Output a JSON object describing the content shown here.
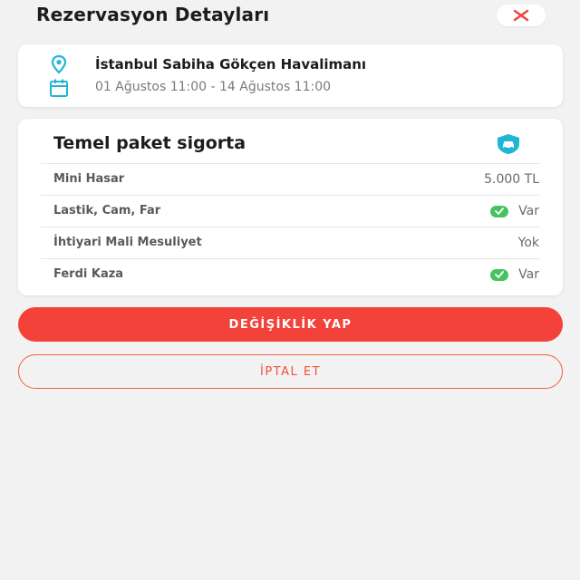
{
  "header": {
    "title": "Rezervasyon Detayları",
    "close_icon": "close-icon"
  },
  "location": {
    "name": "İstanbul Sabiha Gökçen Havalimanı",
    "dates": "01 Ağustos 11:00 - 14 Ağustos 11:00",
    "location_icon": "location-pin-icon",
    "calendar_icon": "calendar-icon"
  },
  "insurance": {
    "title": "Temel paket sigorta",
    "icon": "car-shield-icon",
    "rows": [
      {
        "label": "Mini Hasar",
        "value": "5.000 TL",
        "check": false
      },
      {
        "label": "Lastik, Cam, Far",
        "value": "Var",
        "check": true
      },
      {
        "label": "İhtiyari Mali Mesuliyet",
        "value": "Yok",
        "check": false
      },
      {
        "label": "Ferdi Kaza",
        "value": "Var",
        "check": true
      }
    ]
  },
  "actions": {
    "modify_label": "DEĞİŞİKLİK YAP",
    "cancel_label": "İPTAL ET"
  },
  "colors": {
    "accent": "#f2423a",
    "icon_teal": "#1fb6d6",
    "check_green": "#45c35f"
  }
}
